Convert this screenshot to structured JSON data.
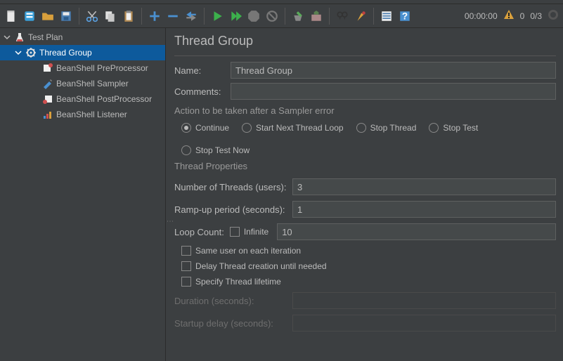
{
  "toolbar": {
    "timer": "00:00:00",
    "warn_count": "0",
    "thread_count": "0/3"
  },
  "tree": {
    "root": {
      "label": "Test Plan"
    },
    "thread_group": {
      "label": "Thread Group"
    },
    "children": [
      {
        "label": "BeanShell PreProcessor"
      },
      {
        "label": "BeanShell Sampler"
      },
      {
        "label": "BeanShell PostProcessor"
      },
      {
        "label": "BeanShell Listener"
      }
    ]
  },
  "panel": {
    "title": "Thread Group",
    "name_label": "Name:",
    "name_value": "Thread Group",
    "comments_label": "Comments:",
    "comments_value": "",
    "action_legend": "Action to be taken after a Sampler error",
    "radios": {
      "continue": "Continue",
      "start_next": "Start Next Thread Loop",
      "stop_thread": "Stop Thread",
      "stop_test": "Stop Test",
      "stop_test_now": "Stop Test Now"
    },
    "thread_props_legend": "Thread Properties",
    "num_threads_label": "Number of Threads (users):",
    "num_threads_value": "3",
    "ramp_up_label": "Ramp-up period (seconds):",
    "ramp_up_value": "1",
    "loop_count_label": "Loop Count:",
    "loop_infinite_label": "Infinite",
    "loop_count_value": "10",
    "same_user_label": "Same user on each iteration",
    "delay_start_label": "Delay Thread creation until needed",
    "specify_lifetime_label": "Specify Thread lifetime",
    "duration_label": "Duration (seconds):",
    "duration_value": "",
    "startup_delay_label": "Startup delay (seconds):",
    "startup_delay_value": ""
  }
}
